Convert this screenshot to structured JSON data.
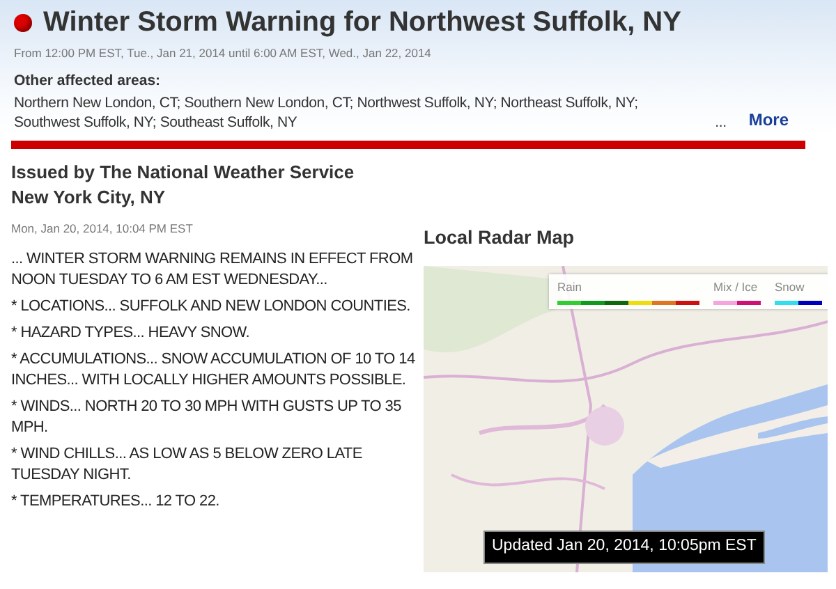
{
  "alert": {
    "title": "Winter Storm Warning for Northwest Suffolk, NY",
    "color": "#dd0000",
    "period": "From 12:00 PM EST, Tue., Jan 21, 2014 until 6:00 AM EST, Wed., Jan 22, 2014"
  },
  "affected_areas": {
    "heading": "Other affected areas:",
    "lines": [
      "Northern New London, CT;  Southern New London, CT;  Northwest Suffolk, NY;  Northeast Suffolk, NY;",
      "Southwest Suffolk, NY;  Southeast Suffolk, NY"
    ],
    "ellipsis": "...",
    "more_link": "More"
  },
  "issuer": {
    "lines": [
      "Issued by The National Weather Service",
      "New York City, NY"
    ],
    "date": "Mon, Jan 20, 2014, 10:04 PM EST"
  },
  "paragraphs": [
    "... WINTER STORM WARNING REMAINS IN EFFECT FROM NOON TUESDAY TO 6 AM EST WEDNESDAY...",
    "* LOCATIONS... SUFFOLK AND NEW LONDON COUNTIES.",
    "* HAZARD TYPES... HEAVY SNOW.",
    "* ACCUMULATIONS... SNOW ACCUMULATION OF 10 TO 14 INCHES... WITH LOCALLY HIGHER AMOUNTS POSSIBLE.",
    "* WINDS... NORTH 20 TO 30 MPH WITH GUSTS UP TO 35 MPH.",
    "* WIND CHILLS... AS LOW AS 5 BELOW ZERO LATE TUESDAY NIGHT.",
    "* TEMPERATURES... 12 TO 22."
  ],
  "radar": {
    "title": "Local Radar Map",
    "legend": [
      {
        "label": "Rain",
        "swatches": [
          {
            "color": "#33cc33"
          },
          {
            "color": "#119922"
          },
          {
            "color": "#116611"
          },
          {
            "color": "#eedd11"
          },
          {
            "color": "#dd7722"
          },
          {
            "color": "#cc1111"
          }
        ]
      },
      {
        "label": "Mix / Ice",
        "swatches": [
          {
            "color": "#f4a6dc"
          },
          {
            "color": "#cc1177"
          }
        ]
      },
      {
        "label": "Snow",
        "swatches": [
          {
            "color": "#33ddee"
          },
          {
            "color": "#0000bb"
          }
        ]
      }
    ],
    "updated": "Updated Jan 20, 2014, 10:05pm EST"
  }
}
